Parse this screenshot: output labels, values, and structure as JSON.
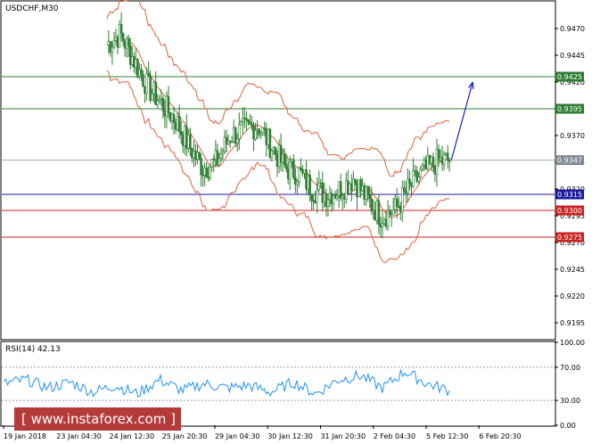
{
  "chart_data": [
    {
      "type": "line",
      "title": "USDCHF,M30",
      "ylim": [
        0.918,
        0.9495
      ],
      "yticks": [
        0.947,
        0.9445,
        0.942,
        0.9395,
        0.937,
        0.9345,
        0.932,
        0.9295,
        0.927,
        0.9245,
        0.922,
        0.9195
      ],
      "xticks": [
        "19 Jan 2018",
        "23 Jan 04:30",
        "24 Jan 12:30",
        "25 Jan 20:30",
        "29 Jan 04:30",
        "30 Jan 12:30",
        "31 Jan 20:30",
        "2 Feb 04:30",
        "5 Feb 12:30",
        "6 Feb 20:30"
      ],
      "levels": [
        {
          "value": 0.9425,
          "label": "0.9425",
          "color": "#2e7d32",
          "box": "#2e7d32"
        },
        {
          "value": 0.9395,
          "label": "0.9395",
          "color": "#2e7d32",
          "box": "#2e7d32"
        },
        {
          "value": 0.9347,
          "label": "0.9347",
          "color": "#a0a8b0",
          "box": "#7f8a95"
        },
        {
          "value": 0.9315,
          "label": "0.9315",
          "color": "#1a1aa0",
          "box": "#1a1aa0"
        },
        {
          "value": 0.93,
          "label": "0.9300",
          "color": "#cc2222",
          "box": "#cc2222"
        },
        {
          "value": 0.9275,
          "label": "0.9275",
          "color": "#cc2222",
          "box": "#cc2222"
        }
      ],
      "projection": {
        "from": 0.9347,
        "to": 0.942,
        "color": "#1a1acc"
      },
      "colors": {
        "candle": "#2e7d32",
        "bands": "#e06040",
        "grid_level_text": "#ffffff",
        "axis": "#000000"
      },
      "series": [
        {
          "x": [
            0.3,
            0.32,
            0.34,
            0.36,
            0.38,
            0.4,
            0.42,
            0.44,
            0.46,
            0.48,
            0.5,
            0.52,
            0.54,
            0.56,
            0.58,
            0.6,
            0.62,
            0.64,
            0.66,
            0.68,
            0.7,
            0.72,
            0.74,
            0.76,
            0.78,
            0.8
          ],
          "values": [
            0.9455,
            0.9465,
            0.944,
            0.9415,
            0.94,
            0.9385,
            0.936,
            0.934,
            0.9345,
            0.937,
            0.9375,
            0.938,
            0.936,
            0.934,
            0.9335,
            0.932,
            0.9315,
            0.932,
            0.933,
            0.931,
            0.9295,
            0.93,
            0.932,
            0.9335,
            0.9345,
            0.9347
          ]
        }
      ]
    },
    {
      "type": "line",
      "title": "RSI(14) 42.13",
      "ylim": [
        0,
        100
      ],
      "yticks": [
        100.0,
        70.0,
        30.0,
        0.0
      ],
      "levels": [
        70,
        30
      ],
      "series": [
        {
          "x": [
            0,
            0.04,
            0.08,
            0.12,
            0.16,
            0.2,
            0.24,
            0.28,
            0.32,
            0.36,
            0.4,
            0.44,
            0.48,
            0.52,
            0.56,
            0.6,
            0.64,
            0.68,
            0.72,
            0.76,
            0.8
          ],
          "values": [
            50,
            55,
            45,
            52,
            40,
            48,
            38,
            55,
            42,
            50,
            45,
            48,
            40,
            52,
            38,
            55,
            60,
            45,
            65,
            50,
            42.13
          ]
        }
      ]
    }
  ],
  "watermark": "[ www.instaforex.com ]"
}
